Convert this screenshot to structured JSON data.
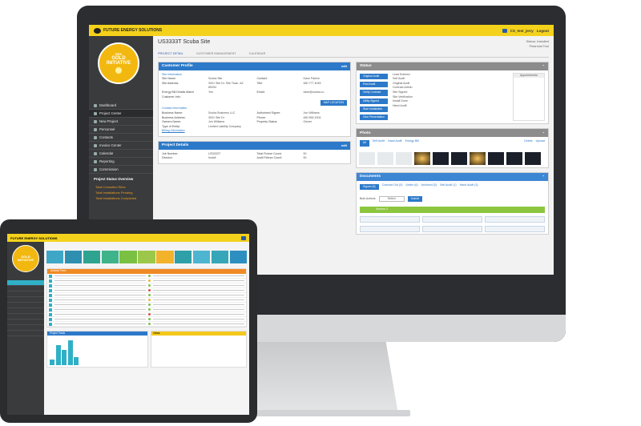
{
  "desktop": {
    "topbar": {
      "brand": "FUTURE ENERGY SOLUTIONS",
      "user": "CS_test_jerry",
      "logout": "Logout"
    },
    "logo": {
      "small": "EES",
      "line1": "GOLD",
      "line2": "INITIATIVE"
    },
    "sidebar": {
      "items": [
        "Dashboard",
        "Project Center",
        "New Project",
        "Personnel",
        "Contacts",
        "Invoice Center",
        "Calendar",
        "Reporting",
        "Commission"
      ],
      "overview_title": "Project Status Overview",
      "overview_items": [
        "Total Consulted Sites",
        "Total Installations Pending",
        "Total Installations Completed"
      ]
    },
    "site": {
      "title": "US3333T  Scuba Site",
      "status": "Status: Installed",
      "financial": "Financial Tool",
      "tabs": [
        "PROJECT DETAIL",
        "CUSTOMER MANAGEMENT",
        "CALENDAR"
      ]
    },
    "customer_profile": {
      "title": "Customer Profile",
      "edit": "edit",
      "section": "Site Information",
      "rows": [
        [
          "Site Name:",
          "Scuba Site",
          "Contact:",
          "Dave Patrick"
        ],
        [
          "Site Address:",
          "3001 Site Dr. Site Town, AZ 85254",
          "Title:",
          "480 777 4045"
        ],
        [
          "Energy Bill Details Match Customer Info:",
          "Yes",
          "Email:",
          "dave@scuba.co"
        ]
      ],
      "button": "MAP LOCATION",
      "contact_section": "Contact Information",
      "contact_rows": [
        [
          "Business Name:",
          "Scuba Business LLC",
          "Authorized Signer:",
          "Jon Williams"
        ],
        [
          "Business Address:",
          "3001 Site Dr",
          "Phone:",
          "480 555 2004"
        ],
        [
          "Owners Name:",
          "Jon Williams",
          "Property Status:",
          "Owner"
        ],
        [
          "Type of Entity:",
          "Limited Liability Company",
          "",
          ""
        ]
      ],
      "billing": "Billing Information"
    },
    "project_details": {
      "title": "Project Details",
      "edit": "edit",
      "rows": [
        [
          "Job Number:",
          "US3333T",
          "Total Fixture Count:",
          "50"
        ],
        [
          "Division:",
          "Install",
          "Audit Fixture Count:",
          "50"
        ]
      ]
    },
    "status": {
      "title": "Status",
      "actions": [
        "Original Audit",
        "Post Audit",
        "Verify Contract",
        "Utility Signed",
        "Start Installation",
        "Give Presentation"
      ],
      "history": [
        "Lead Entered",
        "Self Audit",
        "Original Audit",
        "Contract Admin",
        "Site Signed",
        "Site Verification",
        "Install Done",
        "Hand Audit"
      ],
      "calendar_label": "Appointments"
    },
    "photo": {
      "title": "Photo",
      "filters": [
        "All",
        "Self Audit",
        "Hand Audit",
        "Energy Bill"
      ],
      "actions": [
        "Delete",
        "Upload"
      ]
    },
    "documents": {
      "title": "Documents",
      "tabs": [
        "Signed (8)",
        "Contract Out (0)",
        "Active (6)",
        "Archived (0)",
        "Self Audit (1)",
        "Hand Audit (3)"
      ],
      "bulk": "Bulk Actions",
      "select": "Select",
      "submit": "Submit",
      "version": "Version 2"
    }
  },
  "tablet": {
    "brand": "FUTURE ENERGY SOLUTIONS",
    "logo_line1": "GOLD",
    "logo_line2": "INITIATIVE",
    "activity_title": "Activity Feed",
    "projects_title": "Project Totals",
    "news_title": "News"
  },
  "colors": {
    "yellow": "#f4d21c",
    "blue": "#2c79c9",
    "sidebar": "#3a3b3d",
    "teal": "#2fb0c7",
    "orange": "#f08a24"
  },
  "tiles": [
    "#3ea7c6",
    "#2f8fb0",
    "#2ea38f",
    "#3fb38a",
    "#7ac143",
    "#9bc84a",
    "#f2b22a",
    "#2fa0a8",
    "#4db5cf",
    "#36a6b8",
    "#2c8fbf"
  ],
  "tablet_chart": {
    "values": [
      0.2,
      0.75,
      0.55,
      0.9,
      0.3
    ]
  }
}
